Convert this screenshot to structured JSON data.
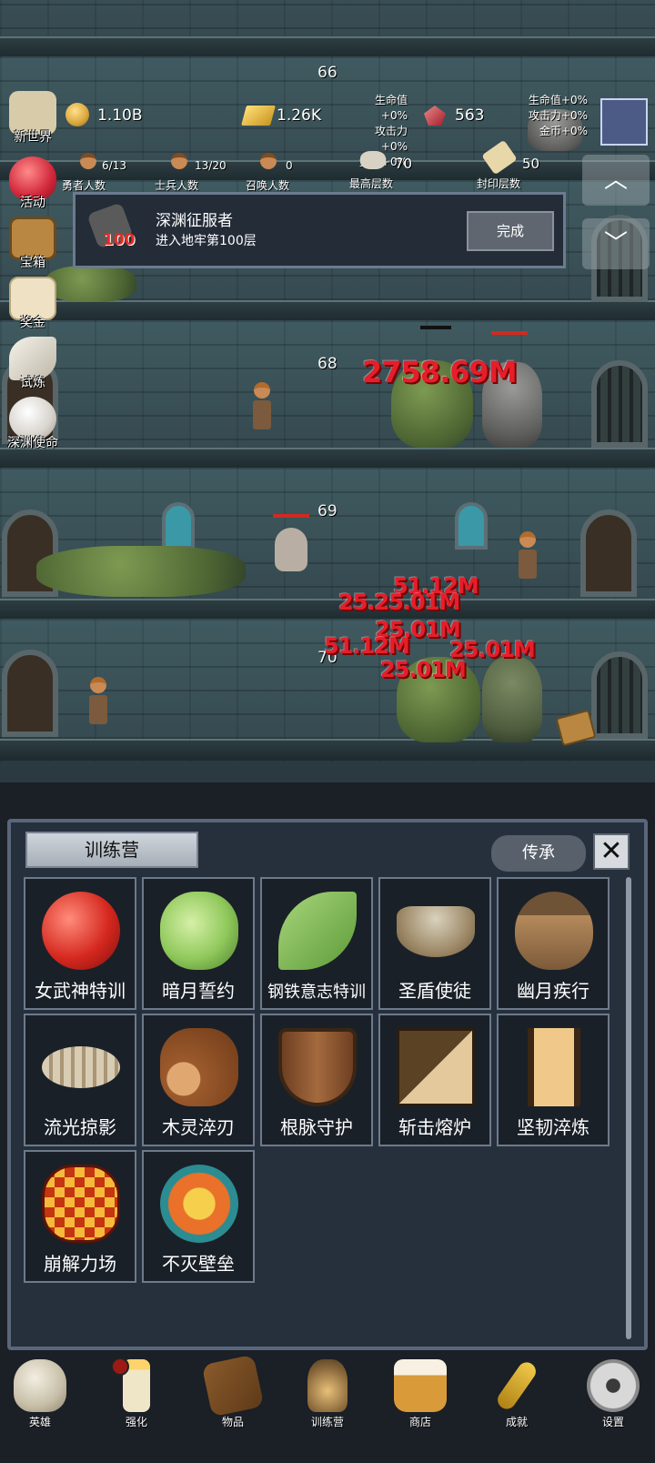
{
  "hud": {
    "floor_top": "66",
    "coins": "1.10B",
    "gold": "1.26K",
    "ruby": "563",
    "bonus_left": {
      "hp": "生命值+0%",
      "atk": "攻击力+0%",
      "coin": "金币+0%"
    },
    "bonus_right": {
      "hp": "生命值+0%",
      "atk": "攻击力+0%",
      "coin": "金币+0%"
    },
    "heroes": {
      "value": "6/13",
      "label": "勇者人数"
    },
    "soldiers": {
      "value": "13/20",
      "label": "士兵人数"
    },
    "summons": {
      "value": "0",
      "label": "召唤人数"
    },
    "max_floor": {
      "value": "70",
      "label": "最高层数"
    },
    "seal_floor": {
      "value": "50",
      "label": "封印层数"
    }
  },
  "side_menu": [
    "新世界",
    "活动",
    "宝箱",
    "奖金",
    "试炼",
    "深渊使命"
  ],
  "quest": {
    "title": "深渊征服者",
    "desc": "进入地牢第100层",
    "badge": "100",
    "button": "完成"
  },
  "floors": {
    "f68": "68",
    "f69": "69",
    "f70": "70"
  },
  "damage": {
    "big": "2758.69M",
    "n1": "51.12M",
    "n2": "25.25.01M",
    "n3": "25.01M",
    "n4": "51.12M",
    "n5": "25.01M",
    "n6": "25.01M"
  },
  "panel": {
    "title": "训练营",
    "inherit": "传承",
    "close": "✕",
    "items": [
      {
        "name": "女武神特训",
        "icon": "apple-icon"
      },
      {
        "name": "暗月誓约",
        "icon": "cabbage-icon"
      },
      {
        "name": "钢铁意志特训",
        "icon": "leaf-icon"
      },
      {
        "name": "圣盾使徒",
        "icon": "bowl-icon"
      },
      {
        "name": "幽月疾行",
        "icon": "acorn-icon"
      },
      {
        "name": "流光掠影",
        "icon": "fish-bone-icon"
      },
      {
        "name": "木灵淬刃",
        "icon": "log-icon"
      },
      {
        "name": "根脉守护",
        "icon": "wooden-shield-icon"
      },
      {
        "name": "斩击熔炉",
        "icon": "block-icon"
      },
      {
        "name": "坚韧淬炼",
        "icon": "tower-shield-icon"
      },
      {
        "name": "崩解力场",
        "icon": "lava-orb-icon"
      },
      {
        "name": "不灭壁垒",
        "icon": "sun-orb-icon"
      }
    ]
  },
  "nav": [
    "英雄",
    "强化",
    "物品",
    "训练营",
    "商店",
    "成就",
    "设置"
  ]
}
